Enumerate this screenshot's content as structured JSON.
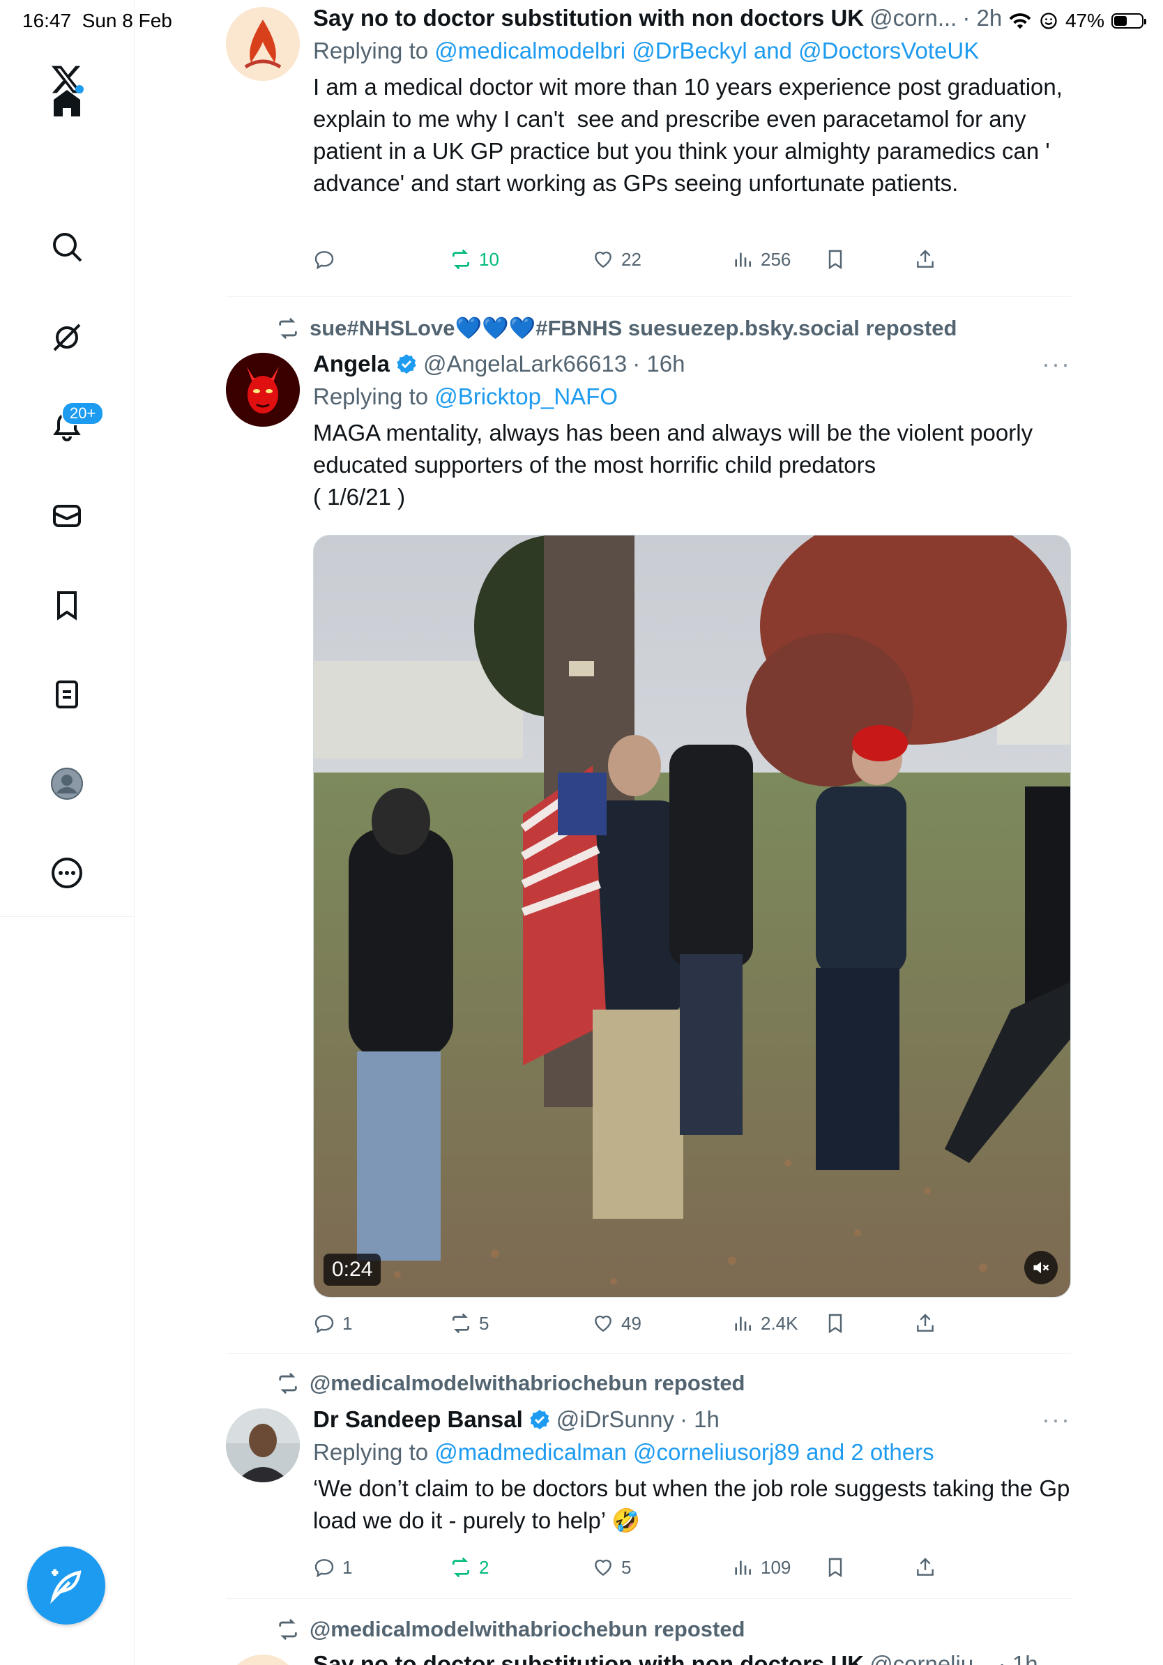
{
  "status_bar": {
    "time": "16:47",
    "date": "Sun 8 Feb",
    "battery": "47%",
    "battery_level": 0.47
  },
  "sidebar": {
    "items": [
      {
        "name": "x-logo",
        "icon": "x-logo-icon"
      },
      {
        "name": "home",
        "icon": "home-icon"
      },
      {
        "name": "search",
        "icon": "search-icon"
      },
      {
        "name": "grok",
        "icon": "grok-icon"
      },
      {
        "name": "notifications",
        "icon": "bell-icon",
        "badge": "20+"
      },
      {
        "name": "messages",
        "icon": "mail-icon"
      },
      {
        "name": "bookmarks",
        "icon": "bookmark-icon"
      },
      {
        "name": "lists",
        "icon": "list-icon"
      },
      {
        "name": "profile",
        "icon": "avatar-icon"
      },
      {
        "name": "more",
        "icon": "more-icon"
      }
    ],
    "compose_icon": "compose-icon"
  },
  "tweets": [
    {
      "name": "Say no to doctor substitution with non doctors UK",
      "handle": "@corn...",
      "time": "· 2h",
      "replying_prefix": "Replying to ",
      "replying_to": "@medicalmodelbri @DrBeckyl and @DoctorsVoteUK",
      "text": "I am a medical doctor wit more than 10 years experience post graduation, explain to me why I can't  see and prescribe even paracetamol for any patient in a UK GP practice but you think your almighty paramedics can ' advance' and start working as GPs seeing unfortunate patients.",
      "stats": {
        "replies": "",
        "retweets": "10",
        "likes": "22",
        "views": "256"
      },
      "retweet_color": "#00ba7c"
    },
    {
      "reposted_by": "sue#NHSLove💙💙💙#FBNHS suesuezep.bsky.social reposted",
      "name": "Angela",
      "handle": "@AngelaLark66613",
      "time": "· 16h",
      "more": "···",
      "replying_prefix": "Replying to ",
      "replying_to": "@Bricktop_NAFO",
      "text": "MAGA mentality, always has been and always will be the violent poorly educated supporters of the most horrific child predators\n( 1/6/21 )",
      "video_duration": "0:24",
      "stats": {
        "replies": "1",
        "retweets": "5",
        "likes": "49",
        "views": "2.4K"
      }
    },
    {
      "reposted_by": "@medicalmodelwithabriochebun reposted",
      "name": "Dr Sandeep Bansal",
      "handle": "@iDrSunny",
      "time": "· 1h",
      "more": "···",
      "replying_prefix": "Replying to ",
      "replying_to": "@madmedicalman @corneliusorj89 and 2 others",
      "text": "‘We don’t claim to be doctors but when the job role suggests taking the Gp load we do it - purely to help’ 🤣",
      "stats": {
        "replies": "1",
        "retweets": "2",
        "likes": "5",
        "views": "109"
      },
      "retweet_color": "#00ba7c"
    },
    {
      "reposted_by": "@medicalmodelwithabriochebun reposted",
      "name": "Say no to doctor substitution with non doctors UK",
      "handle": "@corneliu...",
      "time": "· 1h"
    }
  ],
  "colors": {
    "accent": "#1d9bf0",
    "text_secondary": "#536471",
    "retweet_active": "#00ba7c"
  }
}
